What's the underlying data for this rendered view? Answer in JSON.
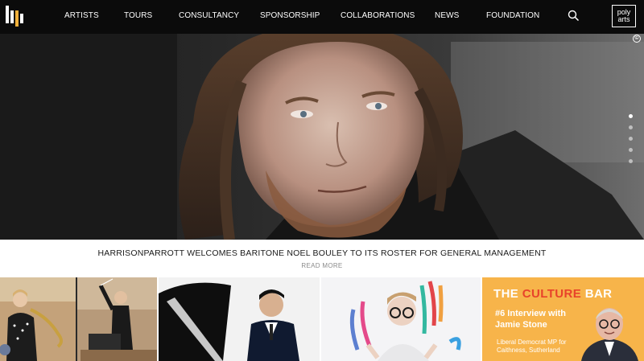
{
  "header": {
    "logo": "hp-logo",
    "nav": [
      {
        "label": "ARTISTS"
      },
      {
        "label": "TOURS"
      },
      {
        "label": "CONSULTANCY"
      },
      {
        "label": "SPONSORSHIP"
      },
      {
        "label": "COLLABORATIONS"
      },
      {
        "label": "NEWS"
      },
      {
        "label": "FOUNDATION"
      }
    ],
    "search_icon": "search-icon",
    "polyarts": {
      "line1": "poly",
      "line2": "arts"
    }
  },
  "hero": {
    "copyright_symbol": "©",
    "slides_total": 5,
    "active_slide": 1
  },
  "caption": {
    "title": "HARRISONPARROTT WELCOMES BARITONE NOEL BOULEY TO ITS ROSTER FOR GENERAL MANAGEMENT",
    "read_more": "READ MORE"
  },
  "tiles": {
    "culture_bar": {
      "title_part1": "THE ",
      "title_part2": "CULTURE",
      "title_part3": " BAR",
      "subtitle": "#6 Interview with Jamie Stone",
      "small": "Liberal Democrat MP for Caithness, Sutherland"
    }
  },
  "colors": {
    "header_bg": "#0b0b0b",
    "culture_bar_bg": "#f7b44a",
    "culture_accent": "#e8432a"
  }
}
